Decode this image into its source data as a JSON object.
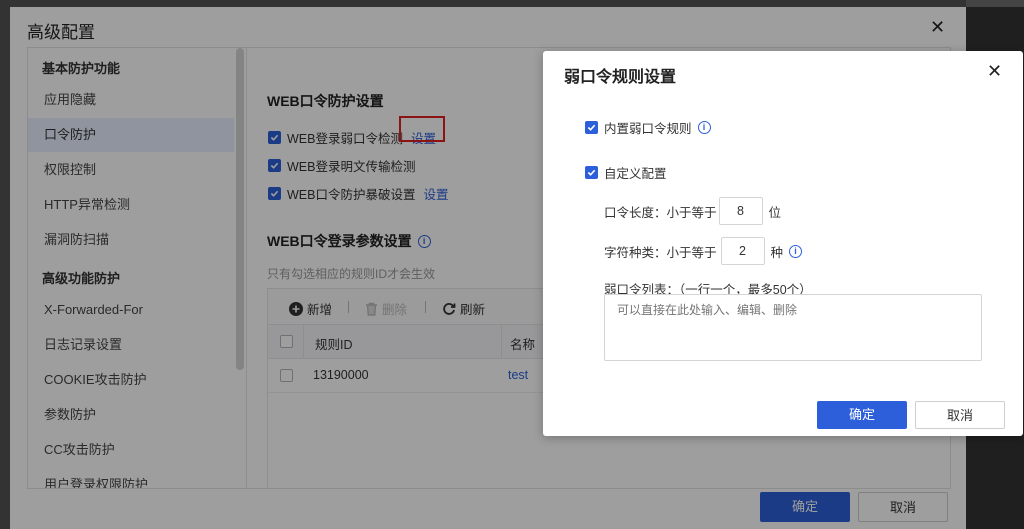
{
  "main_dialog": {
    "title": "高级配置",
    "close_icon": "close-icon",
    "sidebar": {
      "groups": [
        {
          "label": "基本防护功能"
        },
        {
          "label": "高级功能防护"
        }
      ],
      "items": [
        {
          "label": "应用隐藏"
        },
        {
          "label": "口令防护",
          "active": true
        },
        {
          "label": "权限控制"
        },
        {
          "label": "HTTP异常检测"
        },
        {
          "label": "漏洞防扫描"
        },
        {
          "label": "X-Forwarded-For"
        },
        {
          "label": "日志记录设置"
        },
        {
          "label": "COOKIE攻击防护"
        },
        {
          "label": "参数防护"
        },
        {
          "label": "CC攻击防护"
        },
        {
          "label": "用户登录权限防护"
        }
      ]
    },
    "web_password_section": {
      "title": "WEB口令防护设置",
      "options": [
        {
          "label": "WEB登录弱口令检测",
          "checked": true,
          "link": "设置"
        },
        {
          "label": "WEB登录明文传输检测",
          "checked": true
        },
        {
          "label": "WEB口令防护暴破设置",
          "checked": true,
          "link": "设置"
        }
      ]
    },
    "login_params_section": {
      "title": "WEB口令登录参数设置",
      "hint": "只有勾选相应的规则ID才会生效",
      "toolbar": {
        "add": "新增",
        "delete": "删除",
        "refresh": "刷新"
      },
      "table": {
        "headers": [
          "规则ID",
          "名称"
        ],
        "rows": [
          {
            "rule_id": "13190000",
            "name": "test"
          }
        ]
      }
    },
    "footer": {
      "confirm": "确定",
      "cancel": "取消"
    }
  },
  "sub_dialog": {
    "title": "弱口令规则设置",
    "builtin_label": "内置弱口令规则",
    "builtin_checked": true,
    "custom_label": "自定义配置",
    "custom_checked": true,
    "length_label": "口令长度：小于等于",
    "length_value": "8",
    "length_unit": "位",
    "charset_label": "字符种类：小于等于",
    "charset_value": "2",
    "charset_unit": "种",
    "list_label": "弱口令列表：（一行一个，最多50个）",
    "list_placeholder": "可以直接在此处输入、编辑、删除",
    "confirm": "确定",
    "cancel": "取消"
  },
  "colors": {
    "primary": "#2c5fd9",
    "highlight_box": "#e02020",
    "active_item_bg": "#e8efff"
  }
}
